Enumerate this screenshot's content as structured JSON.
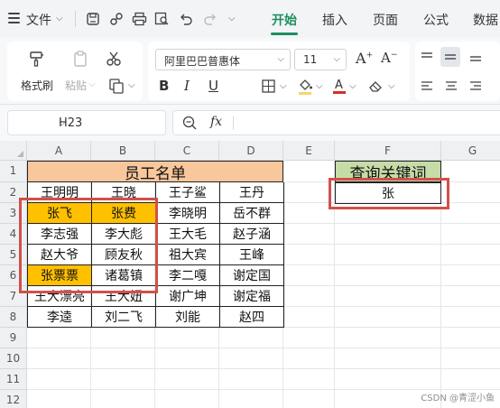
{
  "menubar": {
    "file_label": "文件",
    "tabs": [
      "开始",
      "插入",
      "页面",
      "公式",
      "数据"
    ],
    "active_tab": "开始"
  },
  "ribbon": {
    "format_painter": "格式刷",
    "paste": "粘贴",
    "font_name": "阿里巴巴普惠体",
    "font_size": "11",
    "font_color": "#d32f2f"
  },
  "formula_bar": {
    "cell_ref": "H23",
    "fx": "fx"
  },
  "grid": {
    "columns": [
      "A",
      "B",
      "C",
      "D",
      "E",
      "F",
      "G"
    ],
    "rows": [
      "1",
      "2",
      "3",
      "4",
      "5",
      "6",
      "7",
      "8",
      "9",
      "10",
      "11",
      "12"
    ],
    "title": "员工名单",
    "names": [
      [
        "王明明",
        "王晓",
        "王子鲨",
        "王丹"
      ],
      [
        "张飞",
        "张费",
        "李晓明",
        "岳不群"
      ],
      [
        "李志强",
        "李大彪",
        "王大毛",
        "赵子涵"
      ],
      [
        "赵大爷",
        "顾友秋",
        "祖大宾",
        "王峰"
      ],
      [
        "张票票",
        "诸葛镇",
        "李二嘎",
        "谢定国"
      ],
      [
        "王大漂亮",
        "王大妞",
        "谢广坤",
        "谢定福"
      ],
      [
        "李逵",
        "刘二飞",
        "刘能",
        "赵四"
      ]
    ],
    "highlight_color": "#ffc000",
    "query_header": "查询关键词",
    "query_value": "张"
  },
  "watermark": "CSDN @青涩小鱼"
}
